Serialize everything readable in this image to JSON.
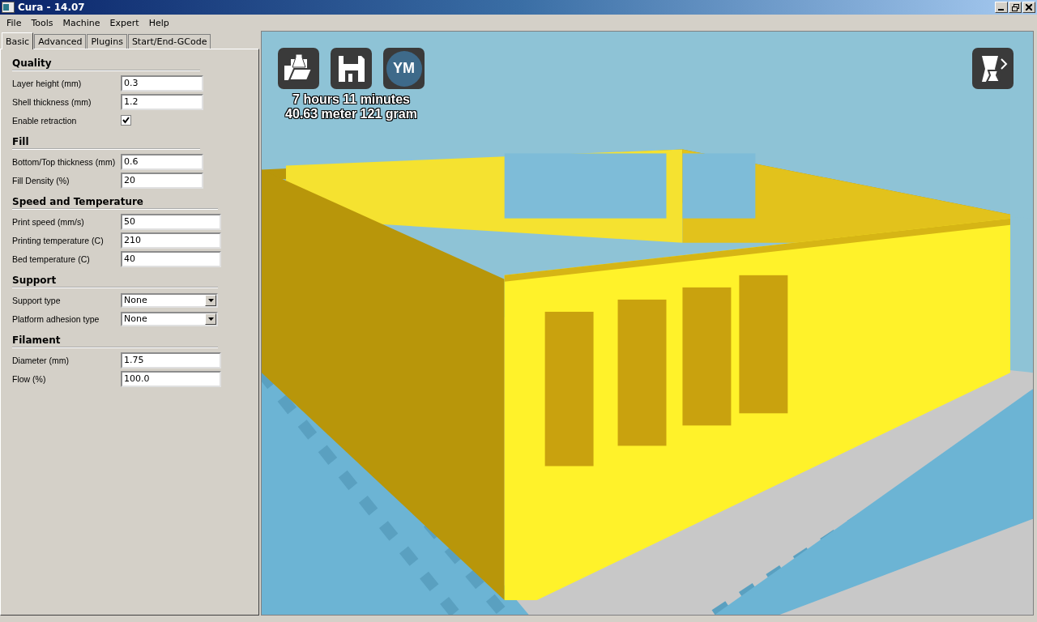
{
  "window": {
    "title": "Cura - 14.07"
  },
  "menu": [
    "File",
    "Tools",
    "Machine",
    "Expert",
    "Help"
  ],
  "tabs": [
    {
      "label": "Basic",
      "selected": true
    },
    {
      "label": "Advanced",
      "selected": false
    },
    {
      "label": "Plugins",
      "selected": false
    },
    {
      "label": "Start/End-GCode",
      "selected": false
    }
  ],
  "sections": [
    {
      "title": "Quality",
      "rows": [
        {
          "kind": "text",
          "label": "Layer height (mm)",
          "value": "0.3"
        },
        {
          "kind": "text",
          "label": "Shell thickness (mm)",
          "value": "1.2"
        },
        {
          "kind": "checkbox",
          "label": "Enable retraction",
          "checked": true
        }
      ]
    },
    {
      "title": "Fill",
      "rows": [
        {
          "kind": "text",
          "label": "Bottom/Top thickness (mm)",
          "value": "0.6"
        },
        {
          "kind": "text",
          "label": "Fill Density (%)",
          "value": "20"
        }
      ]
    },
    {
      "title": "Speed and Temperature",
      "rows": [
        {
          "kind": "text",
          "label": "Print speed (mm/s)",
          "value": "50"
        },
        {
          "kind": "text",
          "label": "Printing temperature (C)",
          "value": "210"
        },
        {
          "kind": "text",
          "label": "Bed temperature (C)",
          "value": "40"
        }
      ]
    },
    {
      "title": "Support",
      "rows": [
        {
          "kind": "select",
          "label": "Support type",
          "value": "None"
        },
        {
          "kind": "select",
          "label": "Platform adhesion type",
          "value": "None"
        }
      ]
    },
    {
      "title": "Filament",
      "rows": [
        {
          "kind": "text",
          "label": "Diameter (mm)",
          "value": "1.75"
        },
        {
          "kind": "text",
          "label": "Flow (%)",
          "value": "100.0"
        }
      ]
    }
  ],
  "viewport": {
    "ym_button": "YM",
    "print_time": "7 hours 11 minutes",
    "material": "40.63 meter 121 gram"
  }
}
